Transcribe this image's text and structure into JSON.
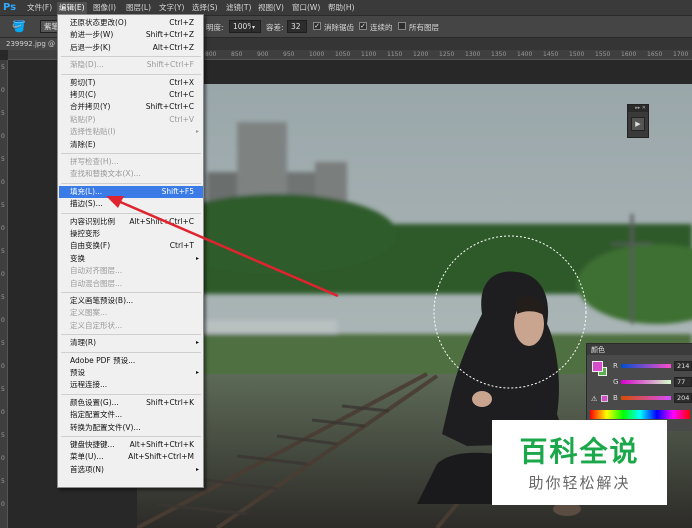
{
  "app": {
    "logo": "Ps"
  },
  "menubar": {
    "items": [
      {
        "label": "文件(F)",
        "active": false
      },
      {
        "label": "编辑(E)",
        "active": true
      },
      {
        "label": "图像(I)",
        "active": false
      },
      {
        "label": "图层(L)",
        "active": false
      },
      {
        "label": "文字(Y)",
        "active": false
      },
      {
        "label": "选择(S)",
        "active": false
      },
      {
        "label": "滤镜(T)",
        "active": false
      },
      {
        "label": "视图(V)",
        "active": false
      },
      {
        "label": "窗口(W)",
        "active": false
      },
      {
        "label": "帮助(H)",
        "active": false
      }
    ]
  },
  "options": {
    "preset_label": "紫笔",
    "opacity_label": "明度:",
    "opacity_value": "100%",
    "tolerance_label": "容差:",
    "tolerance_value": "32",
    "antialias_label": "消除锯齿",
    "contiguous_label": "连续的",
    "all_layers_label": "所有图层"
  },
  "document": {
    "tab_title": "239992.jpg @"
  },
  "rulers": {
    "top": [
      "800",
      "850",
      "900",
      "950",
      "1000",
      "1050",
      "1100",
      "1150",
      "1200",
      "1250",
      "1300",
      "1350",
      "1400",
      "1450",
      "1500",
      "1550",
      "1600",
      "1650",
      "1700"
    ],
    "left": [
      "5",
      "0",
      "5",
      "0",
      "5",
      "0",
      "5",
      "0",
      "5",
      "0",
      "5",
      "0",
      "5",
      "0",
      "5",
      "0",
      "5",
      "0",
      "5",
      "0"
    ]
  },
  "edit_menu": {
    "items": [
      {
        "label": "还原状态更改(O)",
        "shortcut": "Ctrl+Z",
        "disabled": false
      },
      {
        "label": "前进一步(W)",
        "shortcut": "Shift+Ctrl+Z",
        "disabled": false
      },
      {
        "label": "后退一步(K)",
        "shortcut": "Alt+Ctrl+Z",
        "disabled": false
      },
      {
        "sep": true
      },
      {
        "label": "渐隐(D)...",
        "shortcut": "Shift+Ctrl+F",
        "disabled": true
      },
      {
        "sep": true
      },
      {
        "label": "剪切(T)",
        "shortcut": "Ctrl+X",
        "disabled": false
      },
      {
        "label": "拷贝(C)",
        "shortcut": "Ctrl+C",
        "disabled": false
      },
      {
        "label": "合并拷贝(Y)",
        "shortcut": "Shift+Ctrl+C",
        "disabled": false
      },
      {
        "label": "粘贴(P)",
        "shortcut": "Ctrl+V",
        "disabled": true
      },
      {
        "label": "选择性粘贴(I)",
        "shortcut": "",
        "disabled": true,
        "submenu": true
      },
      {
        "label": "清除(E)",
        "shortcut": "",
        "disabled": false
      },
      {
        "sep": true
      },
      {
        "label": "拼写检查(H)...",
        "shortcut": "",
        "disabled": true
      },
      {
        "label": "查找和替换文本(X)...",
        "shortcut": "",
        "disabled": true
      },
      {
        "sep": true
      },
      {
        "label": "填充(L)...",
        "shortcut": "Shift+F5",
        "disabled": false,
        "highlight": true
      },
      {
        "label": "描边(S)...",
        "shortcut": "",
        "disabled": false
      },
      {
        "sep": true
      },
      {
        "label": "内容识别比例",
        "shortcut": "Alt+Shift+Ctrl+C",
        "disabled": false
      },
      {
        "label": "操控变形",
        "shortcut": "",
        "disabled": false
      },
      {
        "label": "自由变换(F)",
        "shortcut": "Ctrl+T",
        "disabled": false
      },
      {
        "label": "变换",
        "shortcut": "",
        "disabled": false,
        "submenu": true
      },
      {
        "label": "自动对齐图层...",
        "shortcut": "",
        "disabled": true
      },
      {
        "label": "自动混合图层...",
        "shortcut": "",
        "disabled": true
      },
      {
        "sep": true
      },
      {
        "label": "定义画笔预设(B)...",
        "shortcut": "",
        "disabled": false
      },
      {
        "label": "定义图案...",
        "shortcut": "",
        "disabled": true
      },
      {
        "label": "定义自定形状...",
        "shortcut": "",
        "disabled": true
      },
      {
        "sep": true
      },
      {
        "label": "清理(R)",
        "shortcut": "",
        "disabled": false,
        "submenu": true
      },
      {
        "sep": true
      },
      {
        "label": "Adobe PDF 预设...",
        "shortcut": "",
        "disabled": false
      },
      {
        "label": "预设",
        "shortcut": "",
        "disabled": false,
        "submenu": true
      },
      {
        "label": "远程连接...",
        "shortcut": "",
        "disabled": false
      },
      {
        "sep": true
      },
      {
        "label": "颜色设置(G)...",
        "shortcut": "Shift+Ctrl+K",
        "disabled": false
      },
      {
        "label": "指定配置文件...",
        "shortcut": "",
        "disabled": false
      },
      {
        "label": "转换为配置文件(V)...",
        "shortcut": "",
        "disabled": false
      },
      {
        "sep": true
      },
      {
        "label": "键盘快捷键...",
        "shortcut": "Alt+Shift+Ctrl+K",
        "disabled": false
      },
      {
        "label": "菜单(U)...",
        "shortcut": "Alt+Shift+Ctrl+M",
        "disabled": false
      },
      {
        "label": "首选项(N)",
        "shortcut": "",
        "disabled": false,
        "submenu": true
      }
    ]
  },
  "color_panel": {
    "title": "颜色",
    "r_label": "R",
    "r_value": "214",
    "g_label": "G",
    "g_value": "77",
    "b_label": "B",
    "b_value": "204",
    "foreground": "#d64dcc",
    "background": "#5ab04a"
  },
  "mini_panel": {
    "collapse": "▸▸ ✕"
  },
  "watermark": {
    "title": "百科全说",
    "subtitle": "助你轻松解决"
  },
  "colors": {
    "annotation_arrow": "#e0242f",
    "highlight": "#3a7be8"
  }
}
